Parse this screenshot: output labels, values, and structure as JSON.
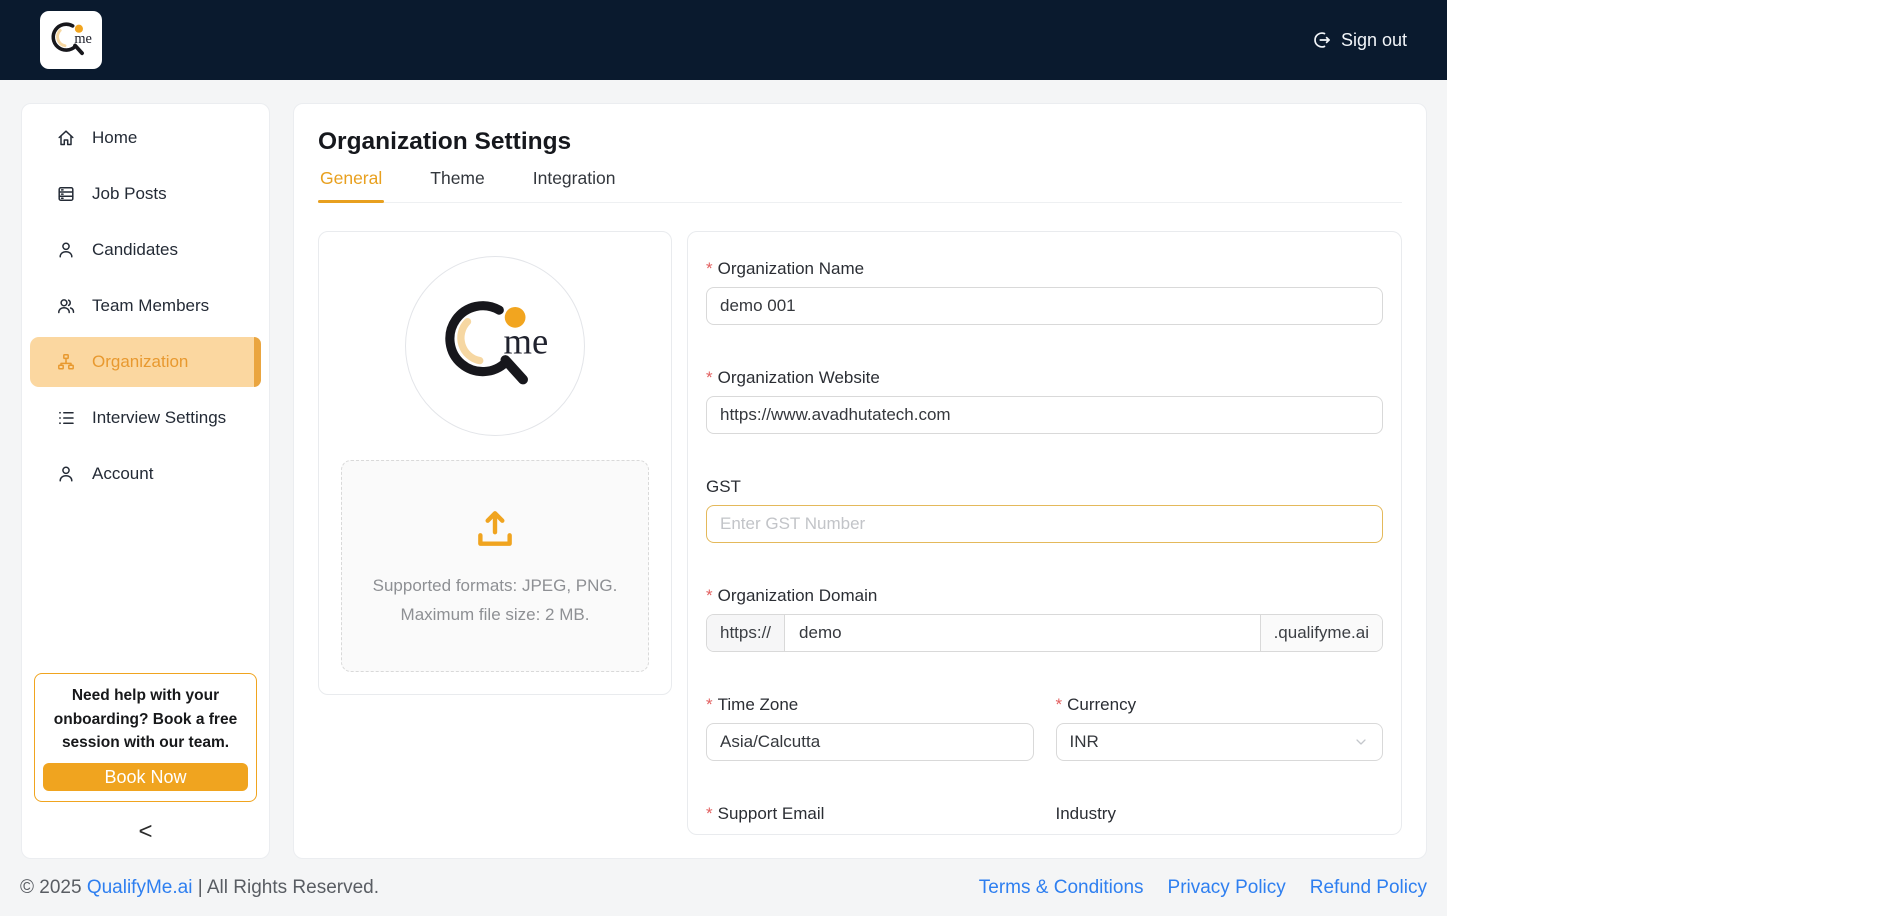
{
  "brand": {
    "logo_text": "me"
  },
  "navbar": {
    "sign_out_label": "Sign out"
  },
  "sidebar": {
    "items": [
      {
        "label": "Home"
      },
      {
        "label": "Job Posts"
      },
      {
        "label": "Candidates"
      },
      {
        "label": "Team Members"
      },
      {
        "label": "Organization",
        "active": true
      },
      {
        "label": "Interview Settings"
      },
      {
        "label": "Account"
      }
    ],
    "help": {
      "text": "Need help with your onboarding? Book a free session with our team.",
      "button_label": "Book Now"
    },
    "collapse_icon": "<"
  },
  "main": {
    "title": "Organization Settings",
    "tabs": [
      {
        "label": "General",
        "active": true
      },
      {
        "label": "Theme"
      },
      {
        "label": "Integration"
      }
    ],
    "upload": {
      "formats_line": "Supported formats: JPEG, PNG.",
      "size_line": "Maximum file size: 2 MB."
    },
    "form": {
      "org_name": {
        "label": "Organization Name",
        "value": "demo 001"
      },
      "org_website": {
        "label": "Organization Website",
        "value": "https://www.avadhutatech.com"
      },
      "gst": {
        "label": "GST",
        "placeholder": "Enter GST Number",
        "value": ""
      },
      "org_domain": {
        "label": "Organization Domain",
        "prefix": "https://",
        "value": "demo",
        "suffix": ".qualifyme.ai"
      },
      "time_zone": {
        "label": "Time Zone",
        "value": "Asia/Calcutta"
      },
      "currency": {
        "label": "Currency",
        "value": "INR"
      },
      "support_email": {
        "label": "Support Email"
      },
      "industry": {
        "label": "Industry"
      }
    }
  },
  "footer": {
    "copyright_prefix": "© 2025",
    "brand_link": "QualifyMe.ai",
    "copyright_suffix": "| All Rights Reserved.",
    "links": [
      {
        "label": "Terms & Conditions"
      },
      {
        "label": "Privacy Policy"
      },
      {
        "label": "Refund Policy"
      }
    ]
  },
  "marks": {
    "required": "*"
  },
  "colors": {
    "navbar_bg": "#0a1a2e",
    "accent_orange": "#f0a41f",
    "active_pill_bg": "#fbd7a0",
    "active_text": "#e8992f",
    "required_red": "#e25f5f",
    "link_blue": "#2e7ff0",
    "page_bg": "#f4f5f6"
  }
}
